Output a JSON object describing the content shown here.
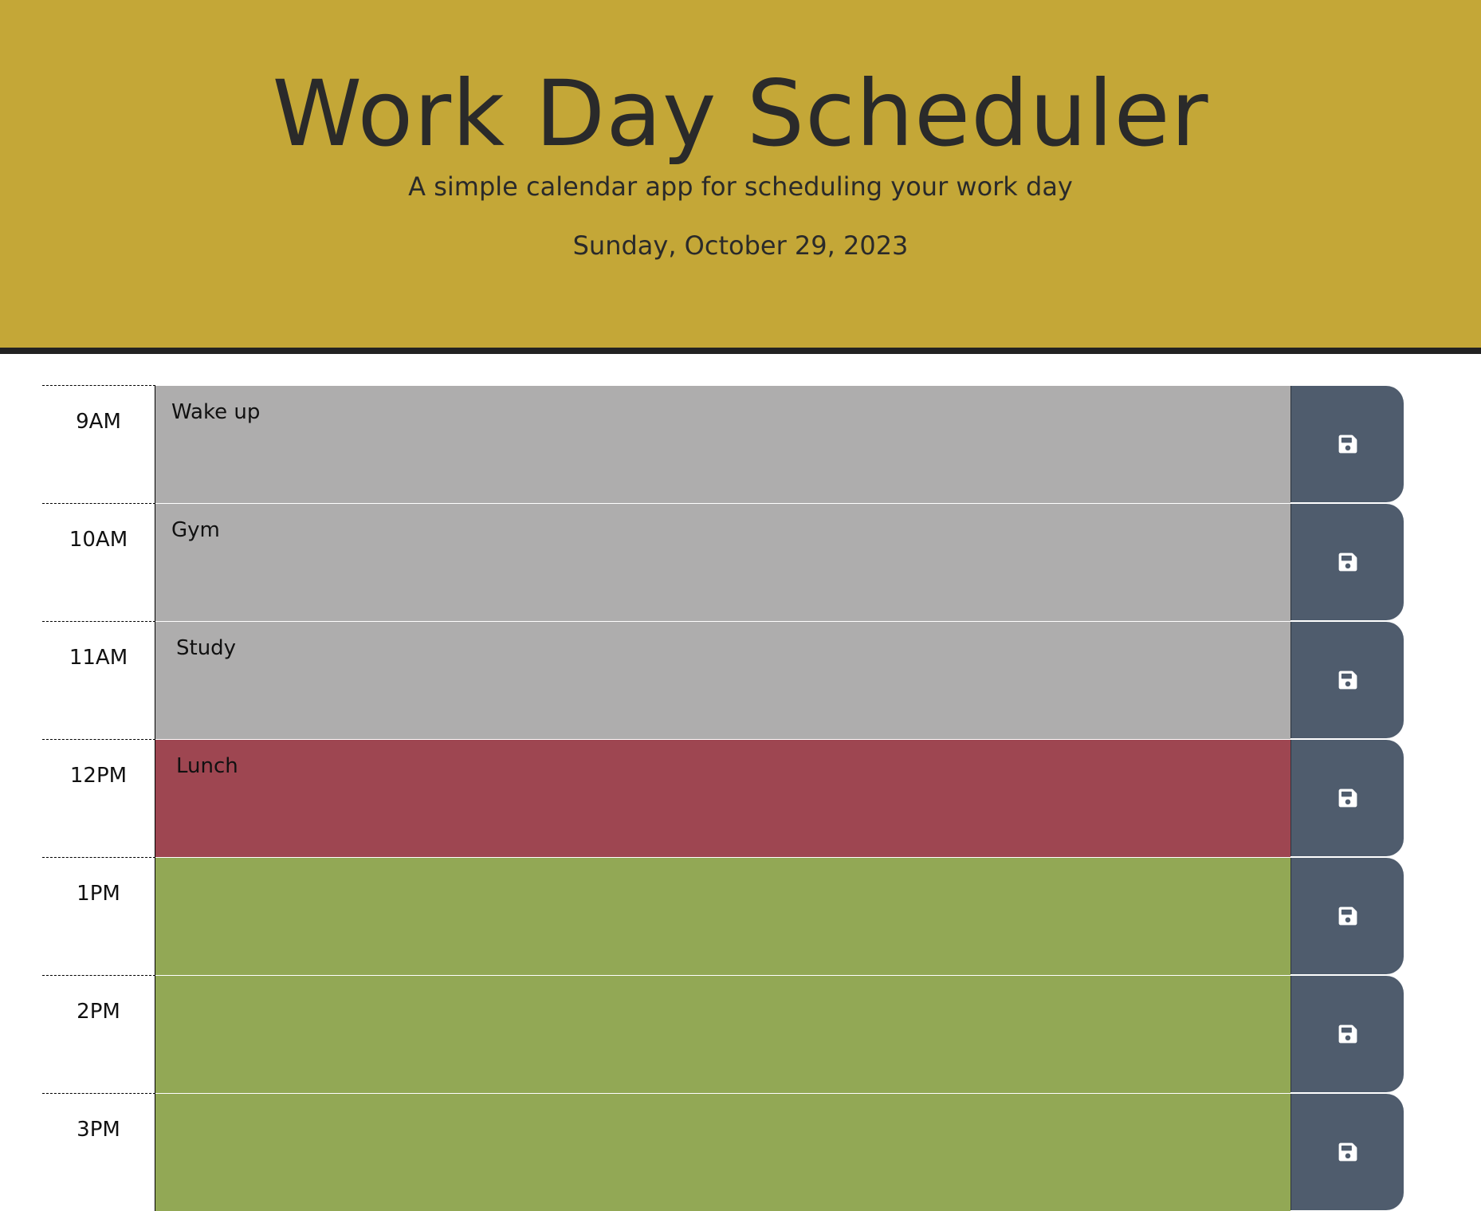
{
  "header": {
    "title": "Work Day Scheduler",
    "subtitle": "A simple calendar app for scheduling your work day",
    "current_date": "Sunday, October 29, 2023"
  },
  "colors": {
    "header_bg": "#c4a737",
    "past": "#aeadad",
    "present": "#9e4651",
    "future": "#92a855",
    "save_button": "#4f5c6d"
  },
  "time_blocks": [
    {
      "hour": "9AM",
      "text": "Wake up",
      "state": "past",
      "save_icon": "save-icon"
    },
    {
      "hour": "10AM",
      "text": "Gym",
      "state": "past",
      "save_icon": "save-icon"
    },
    {
      "hour": "11AM",
      "text": "Study",
      "state": "past",
      "save_icon": "save-icon"
    },
    {
      "hour": "12PM",
      "text": "Lunch",
      "state": "present",
      "save_icon": "save-icon"
    },
    {
      "hour": "1PM",
      "text": "",
      "state": "future",
      "save_icon": "save-icon"
    },
    {
      "hour": "2PM",
      "text": "",
      "state": "future",
      "save_icon": "save-icon"
    },
    {
      "hour": "3PM",
      "text": "",
      "state": "future",
      "save_icon": "save-icon"
    }
  ]
}
